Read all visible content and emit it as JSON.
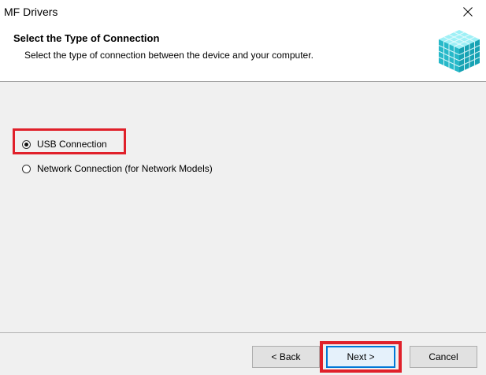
{
  "window": {
    "title": "MF Drivers"
  },
  "header": {
    "title": "Select the Type of Connection",
    "subtitle": "Select the type of connection between the device and your computer."
  },
  "options": [
    {
      "label": "USB Connection",
      "selected": true
    },
    {
      "label": "Network Connection (for Network Models)",
      "selected": false
    }
  ],
  "buttons": {
    "back": "< Back",
    "next": "Next >",
    "cancel": "Cancel"
  },
  "colors": {
    "highlight": "#e0202a",
    "accent": "#0078d7",
    "icon": "#2ec4d6"
  },
  "icons": {
    "close": "close-icon",
    "header": "cube-grid-icon"
  }
}
